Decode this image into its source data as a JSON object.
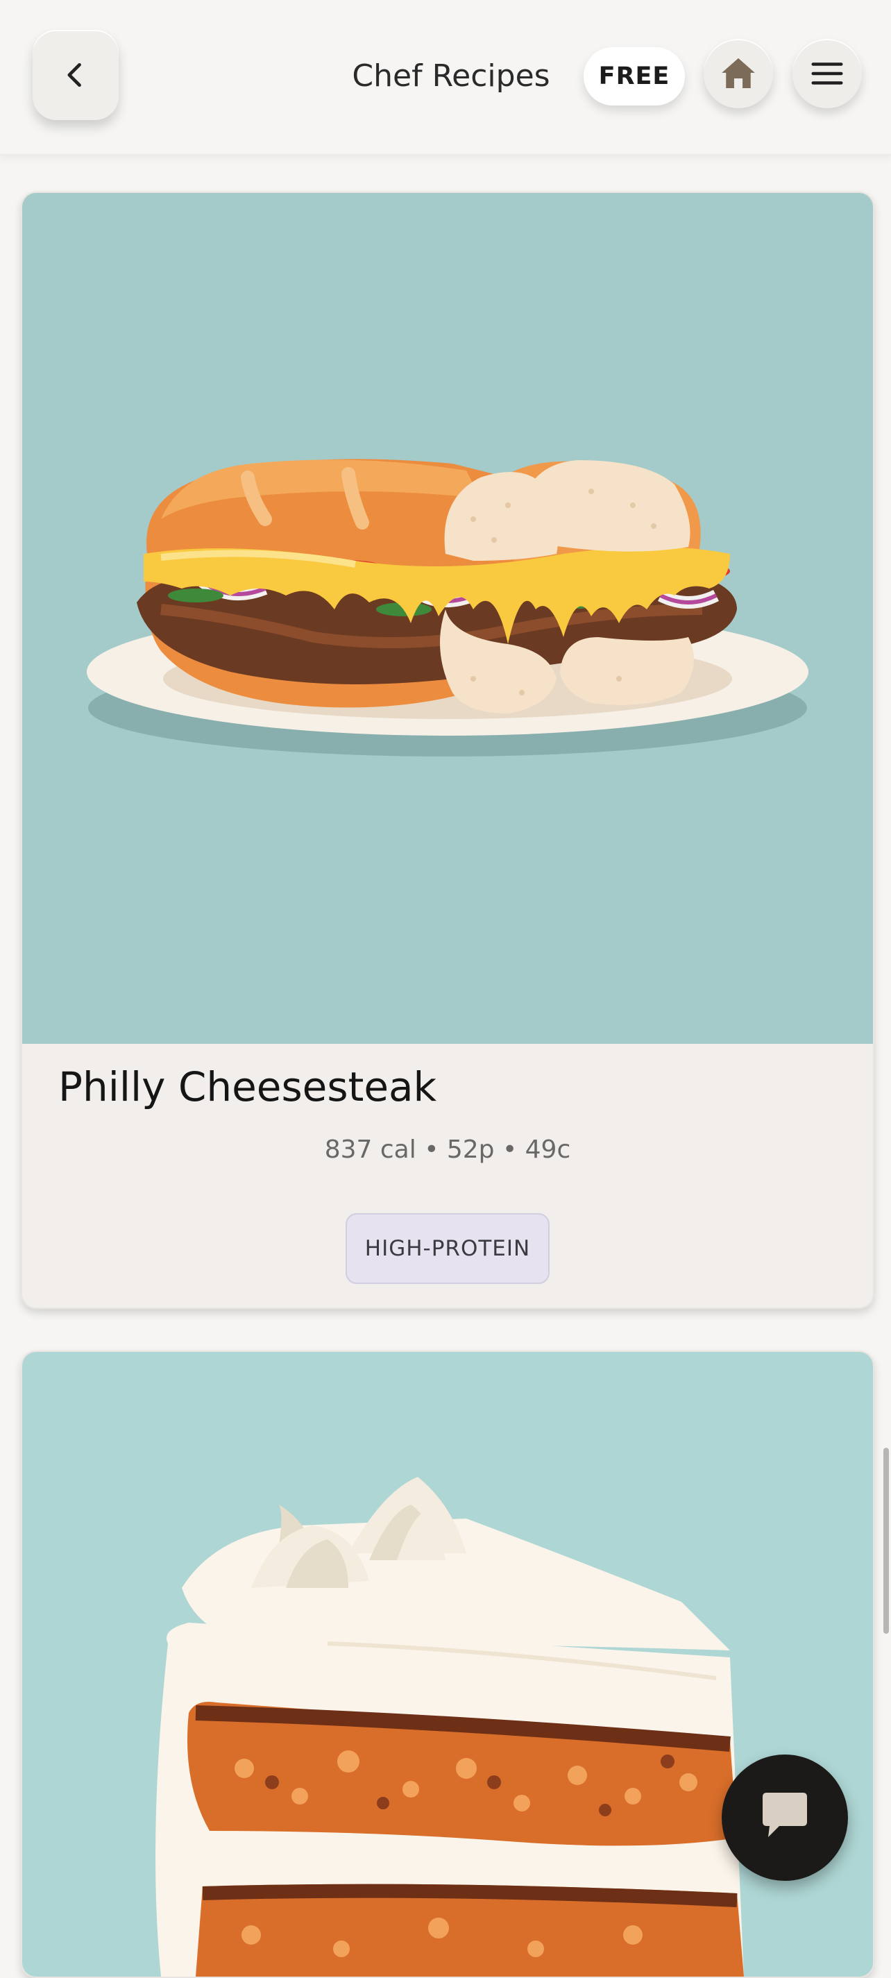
{
  "header": {
    "back_icon": "chevron-left-icon",
    "title": "Chef Recipes",
    "plan_badge": "FREE",
    "home_icon": "home-icon",
    "menu_icon": "hamburger-menu-icon"
  },
  "recipes": [
    {
      "name": "Philly Cheesesteak",
      "macros": "837 cal • 52p • 49c",
      "tag": "HIGH-PROTEIN",
      "image": "philly-cheesesteak-illustration"
    },
    {
      "name": "",
      "image": "layered-carrot-cake-slice-illustration"
    }
  ],
  "chat": {
    "icon": "chat-bubble-icon"
  },
  "colors": {
    "background": "#f6f5f3",
    "card": "#f1eeeb",
    "image_bg_1": "#a4cbca",
    "image_bg_2": "#aed6d4",
    "tag_bg": "#e6e2ef",
    "fab": "#1b1a19"
  }
}
